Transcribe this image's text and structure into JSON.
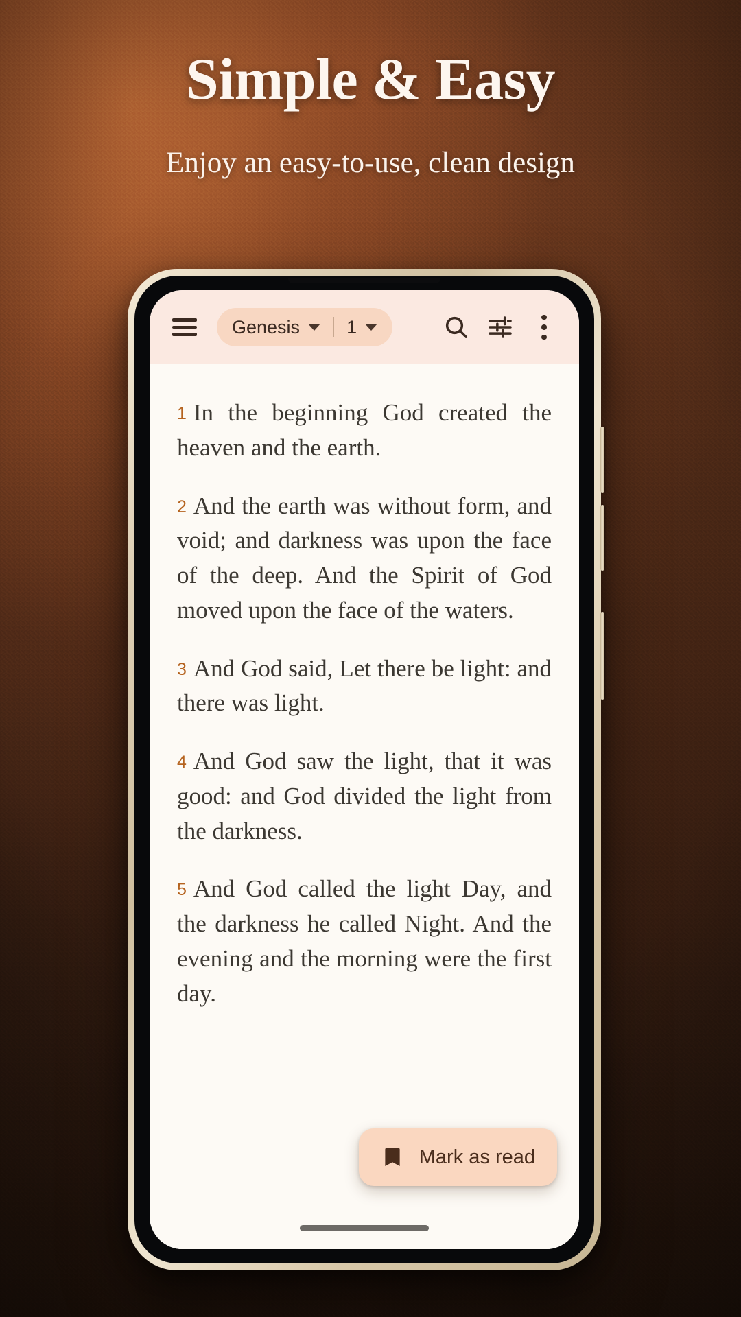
{
  "promo": {
    "headline": "Simple & Easy",
    "subhead": "Enjoy an easy-to-use, clean design"
  },
  "colors": {
    "backdrop_brown": "#6d3a1e",
    "backdrop_highlight": "#c16d38",
    "appbar_bg": "#fbe9e1",
    "pill_bg": "#f8d7c2",
    "reader_bg": "#fdfaf5",
    "verse_text": "#3c3832",
    "verse_number": "#b5631f",
    "fab_bg": "#fad7c0",
    "fab_text": "#4a2d1c",
    "headline_text": "#fdf6ef"
  },
  "appbar": {
    "menu_icon": "hamburger-menu-icon",
    "book_label": "Genesis",
    "book_caret_icon": "chevron-down-icon",
    "divider": "|",
    "chapter_label": "1",
    "chapter_caret_icon": "chevron-down-icon",
    "search_icon": "search-icon",
    "settings_icon": "tune-sliders-icon",
    "overflow_icon": "more-vertical-icon"
  },
  "reader": {
    "verses": [
      {
        "number": "1",
        "text": "In the beginning God created the heaven and the earth."
      },
      {
        "number": "2",
        "text": "And the earth was without form, and void; and darkness was upon the face of the deep. And the Spirit of God moved upon the face of the waters."
      },
      {
        "number": "3",
        "text": "And God said, Let there be light: and there was light."
      },
      {
        "number": "4",
        "text": "And God saw the light, that it was good: and God divided the light from the darkness."
      },
      {
        "number": "5",
        "text": "And God called the light Day, and the darkness he called Night. And the evening and the morning were the first day."
      }
    ]
  },
  "fab": {
    "icon": "bookmark-icon",
    "label": "Mark as read"
  }
}
